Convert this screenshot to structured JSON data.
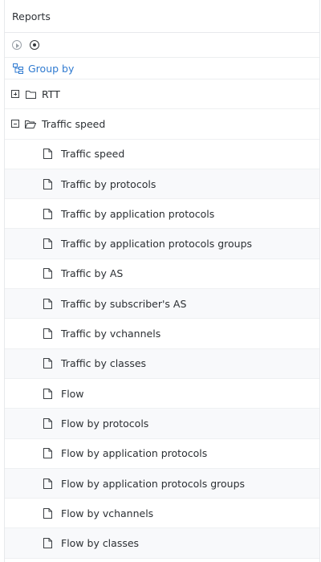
{
  "panel": {
    "title": "Reports"
  },
  "toolbar": {
    "play_icon": "play-circle-icon",
    "stop_icon": "stop-circle-icon"
  },
  "group_by": {
    "label": "Group by",
    "icon": "group-by-icon",
    "color": "#2f7ad0"
  },
  "tree": {
    "rtt": {
      "label": "RTT",
      "expanded": false
    },
    "traffic_speed": {
      "label": "Traffic speed",
      "expanded": true,
      "items": [
        "Traffic speed",
        "Traffic by protocols",
        "Traffic by application protocols",
        "Traffic by application protocols groups",
        "Traffic by AS",
        "Traffic by subscriber's AS",
        "Traffic by vchannels",
        "Traffic by classes",
        "Flow",
        "Flow by protocols",
        "Flow by application protocols",
        "Flow by application protocols groups",
        "Flow by vchannels",
        "Flow by classes"
      ]
    }
  }
}
